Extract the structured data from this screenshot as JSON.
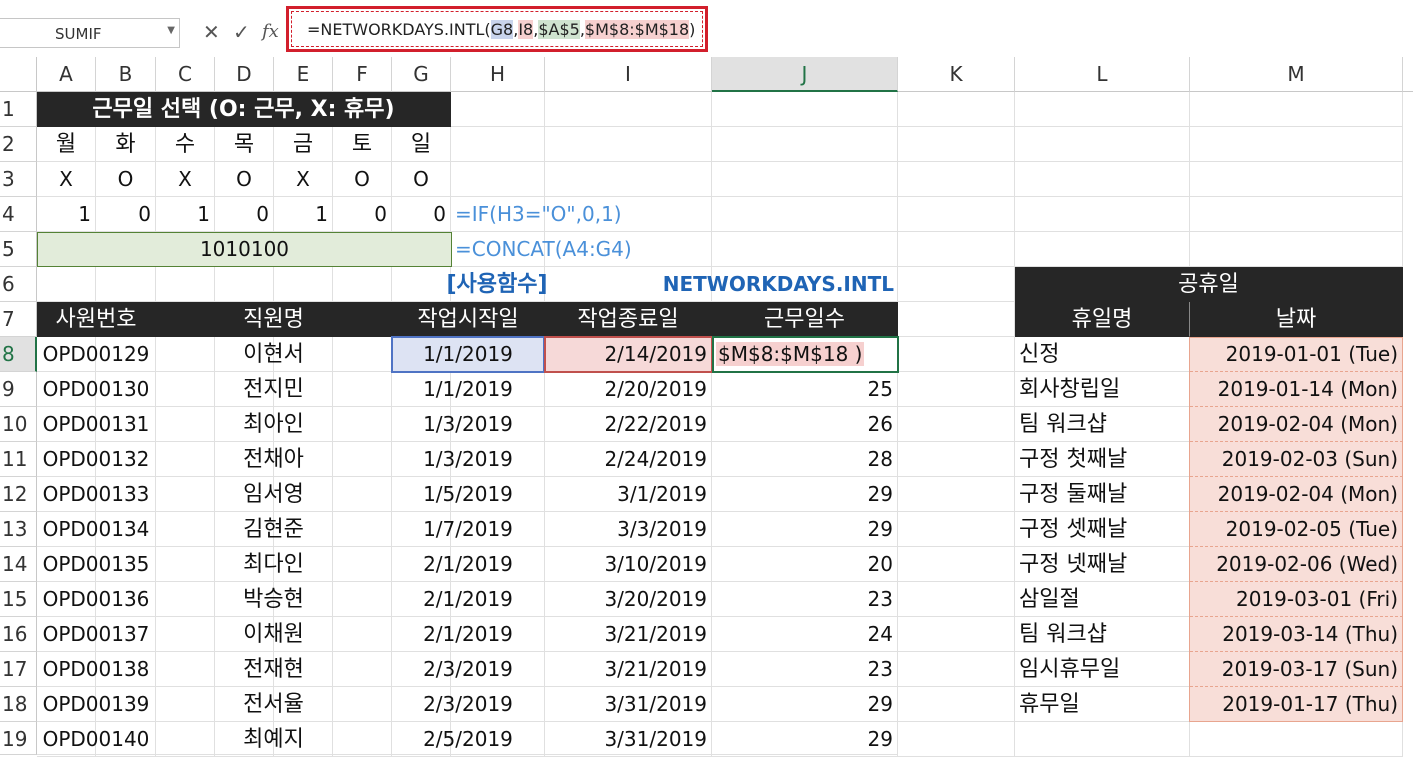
{
  "formula_bar": {
    "name_box": "SUMIF",
    "cancel_icon": "✕",
    "enter_icon": "✓",
    "fx_label": "fx",
    "formula_parts": [
      "=NETWORKDAYS.INTL(",
      "G8",
      ",",
      "I8",
      ",",
      "$A$5",
      ",",
      "$M$8:$M$18",
      ")"
    ]
  },
  "columns": [
    "A",
    "B",
    "C",
    "D",
    "E",
    "F",
    "G",
    "H",
    "I",
    "J",
    "K",
    "L",
    "M"
  ],
  "rows": [
    "1",
    "2",
    "3",
    "4",
    "5",
    "6",
    "7",
    "8",
    "9",
    "10",
    "11",
    "12",
    "13",
    "14",
    "15",
    "16",
    "17",
    "18",
    "19"
  ],
  "weekday_section": {
    "title": "근무일 선택 (O: 근무, X: 휴무)",
    "days": [
      "월",
      "화",
      "수",
      "목",
      "금",
      "토",
      "일"
    ],
    "flags": [
      "X",
      "O",
      "X",
      "O",
      "X",
      "O",
      "O"
    ],
    "bits": [
      "1",
      "0",
      "1",
      "0",
      "1",
      "0",
      "0"
    ],
    "bits_formula": "=IF(H3=\"O\",0,1)",
    "weekend_code": "1010100",
    "concat_formula": "=CONCAT(A4:G4)"
  },
  "section_title": "[사용함수]",
  "function_name": "NETWORKDAYS.INTL",
  "employee_table": {
    "headers": [
      "사원번호",
      "직원명",
      "작업시작일",
      "작업종료일",
      "근무일수"
    ],
    "rows": [
      [
        "OPD00129",
        "이현서",
        "1/1/2019",
        "2/14/2019",
        "$M$8:$M$18 )"
      ],
      [
        "OPD00130",
        "전지민",
        "1/1/2019",
        "2/20/2019",
        "25"
      ],
      [
        "OPD00131",
        "최아인",
        "1/3/2019",
        "2/22/2019",
        "26"
      ],
      [
        "OPD00132",
        "전채아",
        "1/3/2019",
        "2/24/2019",
        "28"
      ],
      [
        "OPD00133",
        "임서영",
        "1/5/2019",
        "3/1/2019",
        "29"
      ],
      [
        "OPD00134",
        "김현준",
        "1/7/2019",
        "3/3/2019",
        "29"
      ],
      [
        "OPD00135",
        "최다인",
        "2/1/2019",
        "3/10/2019",
        "20"
      ],
      [
        "OPD00136",
        "박승현",
        "2/1/2019",
        "3/20/2019",
        "23"
      ],
      [
        "OPD00137",
        "이채원",
        "2/1/2019",
        "3/21/2019",
        "24"
      ],
      [
        "OPD00138",
        "전재현",
        "2/3/2019",
        "3/21/2019",
        "23"
      ],
      [
        "OPD00139",
        "전서율",
        "2/3/2019",
        "3/31/2019",
        "29"
      ],
      [
        "OPD00140",
        "최예지",
        "2/5/2019",
        "3/31/2019",
        "29"
      ]
    ]
  },
  "holiday_table": {
    "title": "공휴일",
    "headers": [
      "휴일명",
      "날짜"
    ],
    "rows": [
      [
        "신정",
        "2019-01-01 (Tue)"
      ],
      [
        "회사창립일",
        "2019-01-14 (Mon)"
      ],
      [
        "팀 워크샵",
        "2019-02-04 (Mon)"
      ],
      [
        "구정 첫째날",
        "2019-02-03 (Sun)"
      ],
      [
        "구정 둘째날",
        "2019-02-04 (Mon)"
      ],
      [
        "구정 셋째날",
        "2019-02-05 (Tue)"
      ],
      [
        "구정 넷째날",
        "2019-02-06 (Wed)"
      ],
      [
        "삼일절",
        "2019-03-01 (Fri)"
      ],
      [
        "팀 워크샵",
        "2019-03-14 (Thu)"
      ],
      [
        "임시휴무일",
        "2019-03-17 (Sun)"
      ],
      [
        "휴무일",
        "2019-01-17 (Thu)"
      ]
    ]
  },
  "colors": {
    "accent_green": "#217346",
    "dark_header": "#262626",
    "range_pink": "#f8ded8",
    "formula_border_red": "#d21f2c"
  }
}
